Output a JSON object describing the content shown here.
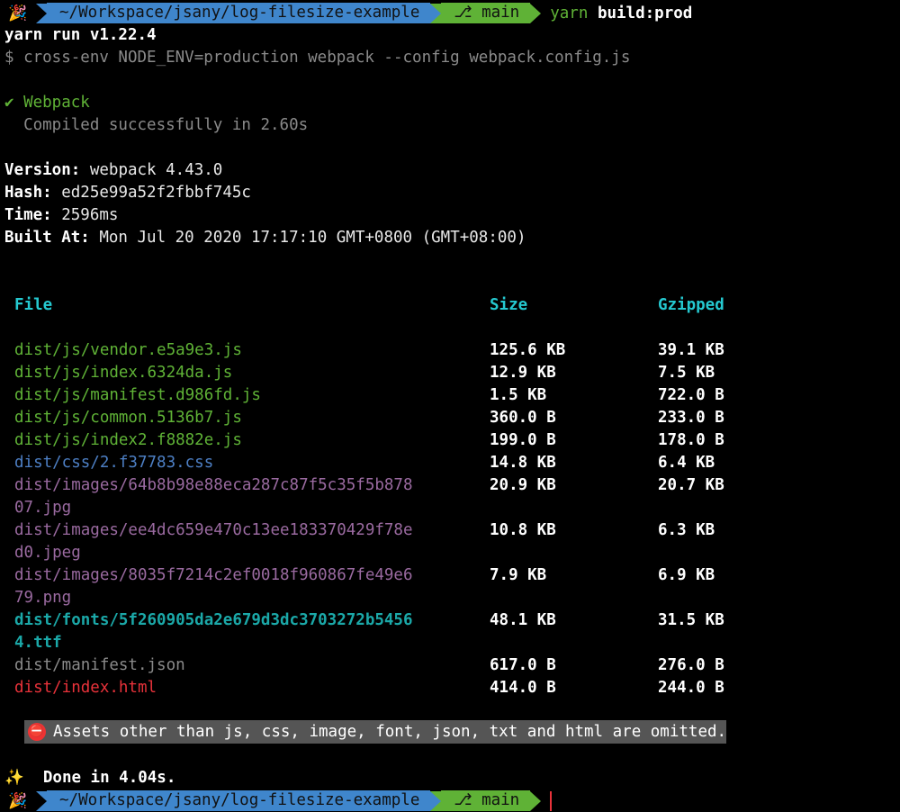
{
  "prompt": {
    "emoji": "🎉",
    "path": "~/Workspace/jsany/log-filesize-example",
    "branch_icon": "git-branch-icon",
    "branch": "main",
    "command_program": "yarn",
    "command_args": "build:prod"
  },
  "output": {
    "yarn_version": "yarn run v1.22.4",
    "script_line": "$ cross-env NODE_ENV=production webpack --config webpack.config.js",
    "webpack_check": "✔ Webpack",
    "compiled": "  Compiled successfully in 2.60s",
    "version_label": "Version:",
    "version_value": " webpack 4.43.0",
    "hash_label": "Hash:",
    "hash_value": " ed25e99a52f2fbbf745c",
    "time_label": "Time:",
    "time_value": " 2596ms",
    "built_label": "Built At:",
    "built_value": " Mon Jul 20 2020 17:17:10 GMT+0800 (GMT+08:00)"
  },
  "table": {
    "headers": [
      "File",
      "Size",
      "Gzipped"
    ],
    "rows": [
      {
        "file": "dist/js/vendor.e5a9e3.js",
        "file2": "",
        "size": "125.6 KB",
        "gzip": "39.1 KB",
        "color": "green"
      },
      {
        "file": "dist/js/index.6324da.js",
        "file2": "",
        "size": "12.9 KB",
        "gzip": "7.5 KB",
        "color": "green"
      },
      {
        "file": "dist/js/manifest.d986fd.js",
        "file2": "",
        "size": "1.5 KB",
        "gzip": "722.0 B",
        "color": "green"
      },
      {
        "file": "dist/js/common.5136b7.js",
        "file2": "",
        "size": "360.0 B",
        "gzip": "233.0 B",
        "color": "green"
      },
      {
        "file": "dist/js/index2.f8882e.js",
        "file2": "",
        "size": "199.0 B",
        "gzip": "178.0 B",
        "color": "green"
      },
      {
        "file": "dist/css/2.f37783.css",
        "file2": "",
        "size": "14.8 KB",
        "gzip": "6.4 KB",
        "color": "blue"
      },
      {
        "file": "dist/images/64b8b98e88eca287c87f5c35f5b878",
        "file2": "07.jpg",
        "size": "20.9 KB",
        "gzip": "20.7 KB",
        "color": "magenta"
      },
      {
        "file": "dist/images/ee4dc659e470c13ee183370429f78e",
        "file2": "d0.jpeg",
        "size": "10.8 KB",
        "gzip": "6.3 KB",
        "color": "magenta"
      },
      {
        "file": "dist/images/8035f7214c2ef0018f960867fe49e6",
        "file2": "79.png",
        "size": "7.9 KB",
        "gzip": "6.9 KB",
        "color": "magenta"
      },
      {
        "file": "dist/fonts/5f260905da2e679d3dc3703272b5456",
        "file2": "4.ttf",
        "size": "48.1 KB",
        "gzip": "31.5 KB",
        "color": "teal"
      },
      {
        "file": "dist/manifest.json",
        "file2": "",
        "size": "617.0 B",
        "gzip": "276.0 B",
        "color": "gray"
      },
      {
        "file": "dist/index.html",
        "file2": "",
        "size": "414.0 B",
        "gzip": "244.0 B",
        "color": "red"
      }
    ]
  },
  "notice": {
    "icon": "no-entry-icon",
    "text": "Assets other than js, css, image, font, json, txt and html are omitted."
  },
  "done": {
    "icon": "sparkles-icon",
    "emoji": "✨",
    "text": "Done in 4.04s."
  }
}
